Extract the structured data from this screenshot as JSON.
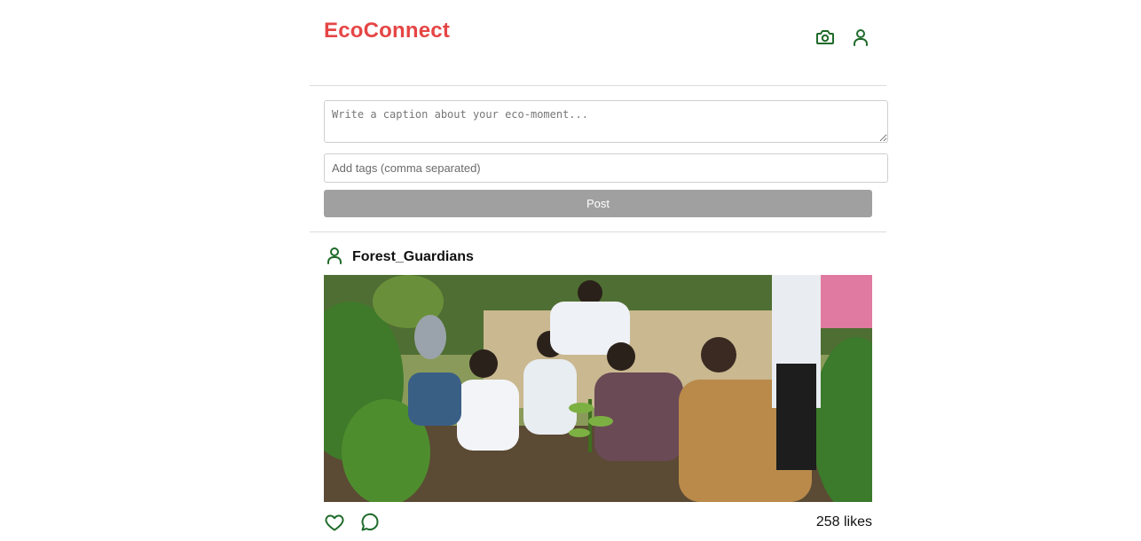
{
  "header": {
    "brand": "EcoConnect",
    "icons": [
      "camera-icon",
      "user-icon"
    ]
  },
  "composer": {
    "caption_placeholder": "Write a caption about your eco-moment...",
    "caption_value": "",
    "tags_placeholder": "Add tags (comma separated)",
    "tags_value": "",
    "post_label": "Post"
  },
  "feed": {
    "posts": [
      {
        "username": "Forest_Guardians",
        "avatar_icon": "user-icon",
        "image_subject": "people-planting-saplings-photo",
        "likes_text": "258 likes",
        "action_icons": [
          "heart-icon",
          "comment-icon"
        ]
      }
    ]
  },
  "colors": {
    "brand": "#e64545",
    "icon_green": "#1f6b2a",
    "button_disabled": "#a0a0a0",
    "divider": "#dcdcdc"
  }
}
